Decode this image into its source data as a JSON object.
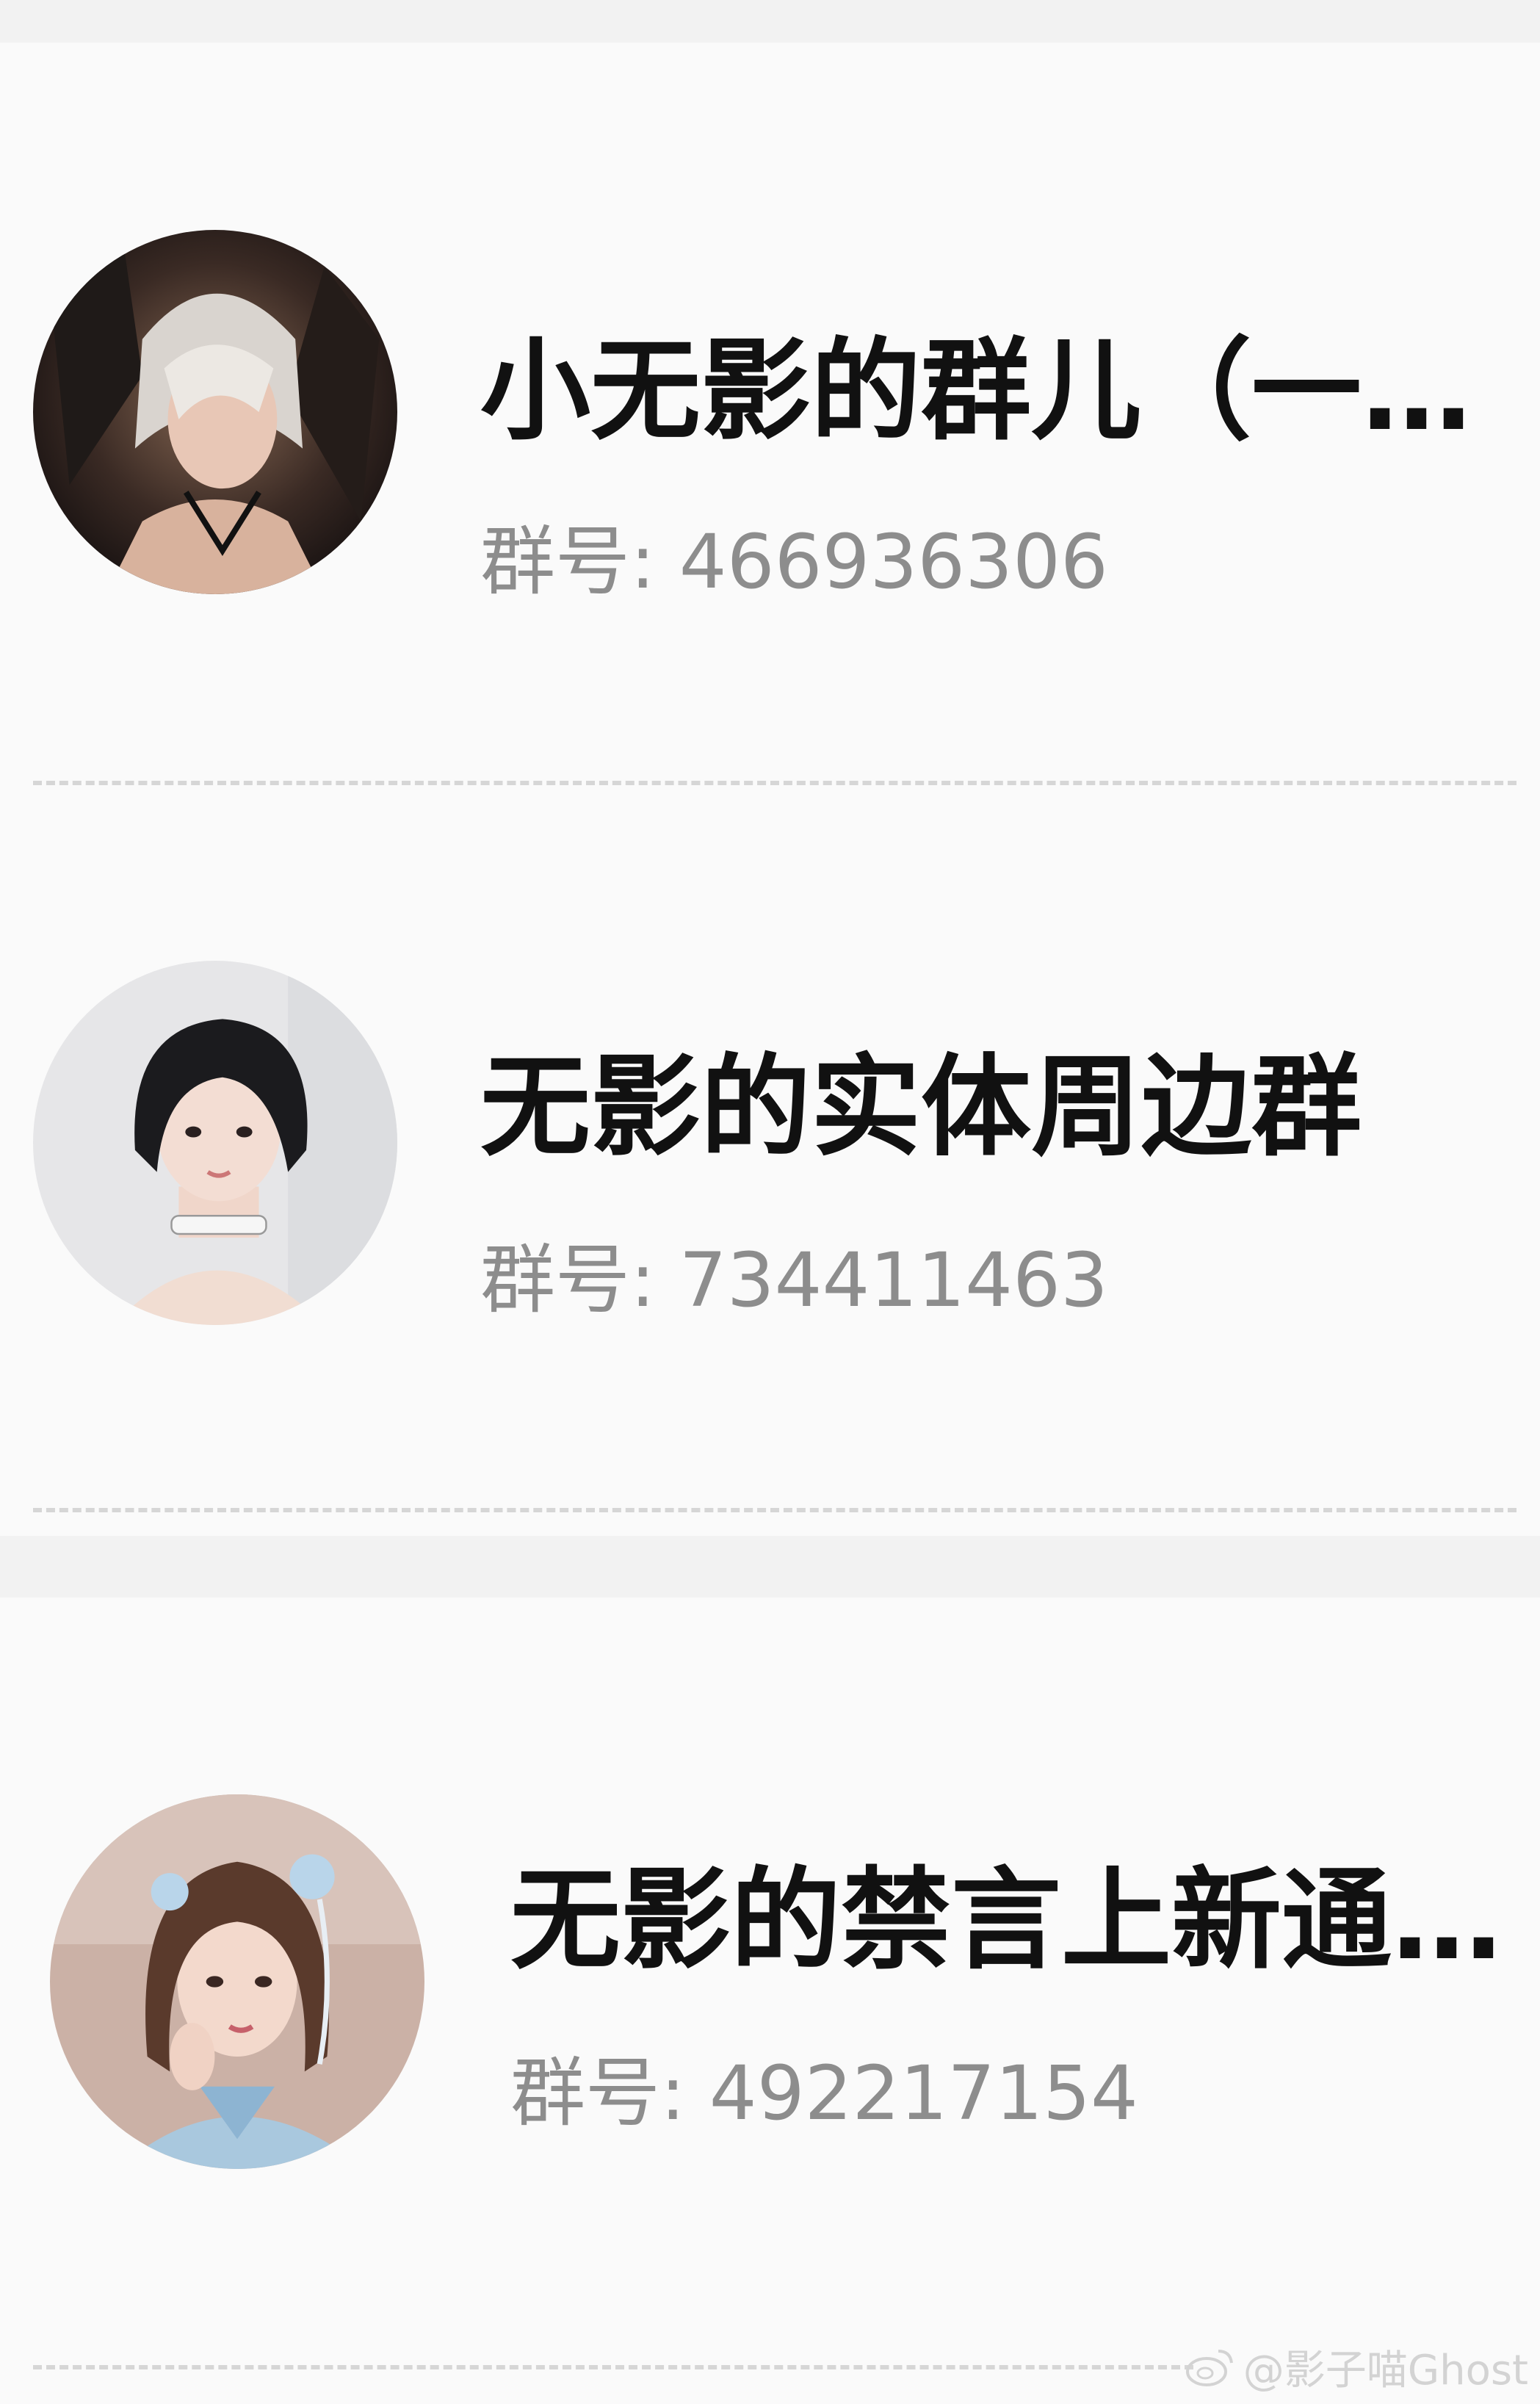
{
  "groups": [
    {
      "name": "小无影的群儿（一…",
      "id_label": "群号: ",
      "id": "466936306",
      "avatar": "avatar-dark-costume"
    },
    {
      "name": "无影的实体周边群",
      "id_label": "群号: ",
      "id": "734411463",
      "avatar": "avatar-short-black-hair"
    },
    {
      "name": "无影的禁言上新通…",
      "id_label": "群号: ",
      "id": "492217154",
      "avatar": "avatar-brown-hair-qipao"
    }
  ],
  "watermark": {
    "text": "@影子喵Ghost",
    "icon": "weibo-icon"
  }
}
